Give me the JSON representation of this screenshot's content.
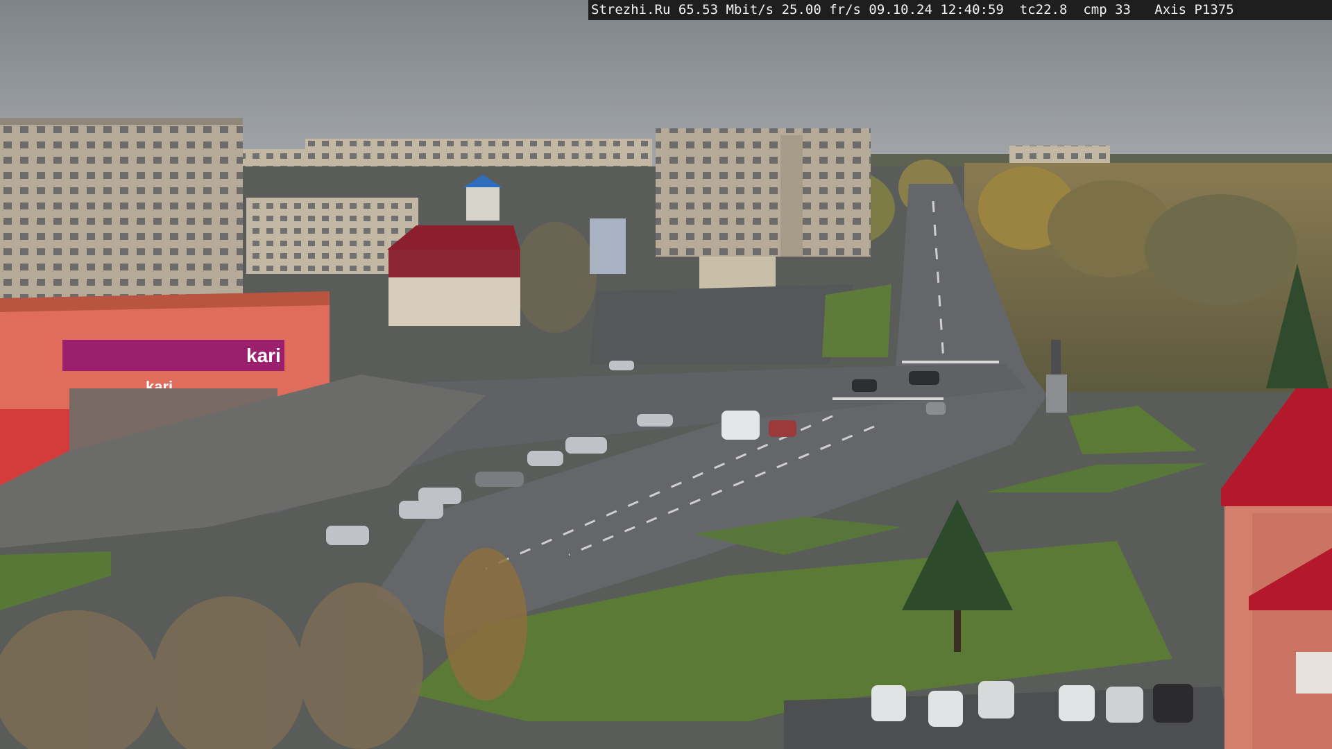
{
  "overlay": {
    "site": "Strezhi.Ru",
    "bitrate": "65.53 Mbit/s",
    "framerate": "25.00 fr/s",
    "date": "09.10.24",
    "time": "12:40:59",
    "tc": "tc22.8",
    "cmp": "cmp 33",
    "camera": "Axis P1375"
  },
  "signs": {
    "store_large": "kari",
    "store_small": "kari"
  },
  "colors": {
    "sky": "#8e9399",
    "asphalt": "#5f6164",
    "grass": "#5b7a36",
    "brick_panel": "#b7ab97",
    "kari_magenta": "#9c1f6e",
    "red_roof": "#b3192b"
  }
}
